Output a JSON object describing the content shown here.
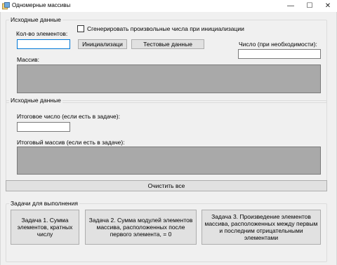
{
  "window": {
    "title": "Одномерные массивы",
    "minimize_glyph": "—",
    "maximize_glyph": "☐",
    "close_glyph": "✕"
  },
  "input_group": {
    "title": "Исходные данные",
    "count_label": "Кол-во элементов:",
    "count_value": "",
    "random_checkbox_label": "Сгенерировать произвольные числа при инициализации",
    "random_checkbox_checked": false,
    "init_button": "Инициализаци",
    "test_data_button": "Тестовые данные",
    "number_label": "Число (при необходимости):",
    "number_value": "",
    "array_label": "Массив:"
  },
  "output_group": {
    "title": "Исходные данные",
    "result_number_label": "Итоговое число (если есть в задаче):",
    "result_number_value": "",
    "result_array_label": "Итоговый массив (если есть в задаче):"
  },
  "clear_button": "Очистить все",
  "tasks_group": {
    "title": "Задачи для выполнения",
    "task1": "Задача 1. Сумма элементов, кратных числу",
    "task2": "Задача 2. Сумма модулей элементов массива, расположенных после первого элемента, = 0",
    "task3": "Задача 3. Произведение элементов массива, расположенных между первым и последним отрицательными элементами"
  }
}
